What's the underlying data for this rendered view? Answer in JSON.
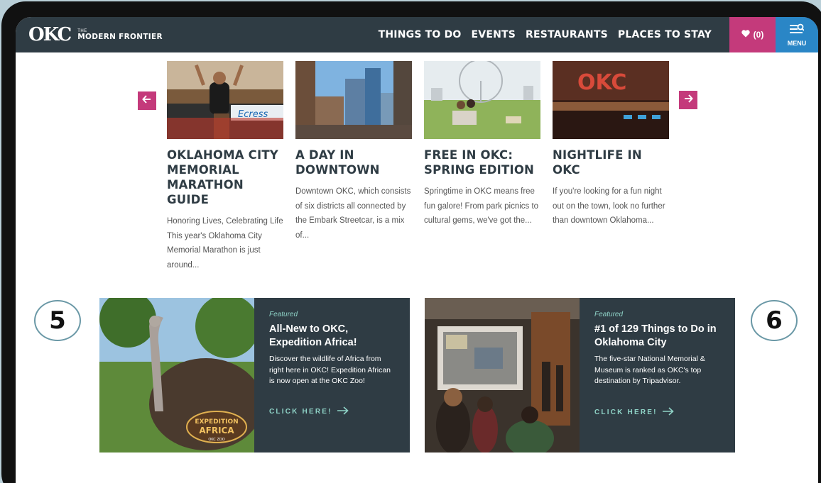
{
  "header": {
    "logo_mark": "OKC",
    "logo_the": "THE",
    "logo_frontier": "MODERN FRONTIER",
    "nav": [
      "THINGS TO DO",
      "EVENTS",
      "RESTAURANTS",
      "PLACES TO STAY"
    ],
    "favorites_count": "(0)",
    "menu_label": "MENU"
  },
  "carousel": {
    "cards": [
      {
        "title": "OKLAHOMA CITY MEMORIAL MARATHON GUIDE",
        "desc": "Honoring Lives, Celebrating Life This year's Oklahoma City Memorial Marathon is just around..."
      },
      {
        "title": "A DAY IN DOWNTOWN",
        "desc": "Downtown OKC, which consists of six districts all connected by the Embark Streetcar, is a mix of..."
      },
      {
        "title": "FREE IN OKC: SPRING EDITION",
        "desc": "Springtime in OKC means free fun galore! From park picnics to cultural gems, we've got the..."
      },
      {
        "title": "NIGHTLIFE IN OKC",
        "desc": "If you're looking for a fun night out on the town, look no further than downtown Oklahoma..."
      }
    ]
  },
  "features": [
    {
      "label": "Featured",
      "title": "All-New to OKC, Expedition Africa!",
      "desc": "Discover the wildlife of Africa from right here in OKC! Expedition African is now open at the OKC Zoo!",
      "cta": "CLICK HERE!",
      "badge_line1": "EXPEDITION",
      "badge_line2": "AFRICA",
      "badge_line3": "OKC ZOO"
    },
    {
      "label": "Featured",
      "title": "#1 of 129 Things to Do in Oklahoma City",
      "desc": "The five-star National Memorial & Museum is ranked as OKC's top destination by Tripadvisor.",
      "cta": "CLICK HERE!"
    }
  ],
  "callouts": [
    "5",
    "6"
  ],
  "colors": {
    "header_bg": "#2f3c44",
    "accent_pink": "#c43a7b",
    "menu_blue": "#2a86c6",
    "teal": "#8fd3c7"
  },
  "card_image_ocr": {
    "marathon_sign": "Ecress",
    "nightlife_sign": "OKC"
  }
}
